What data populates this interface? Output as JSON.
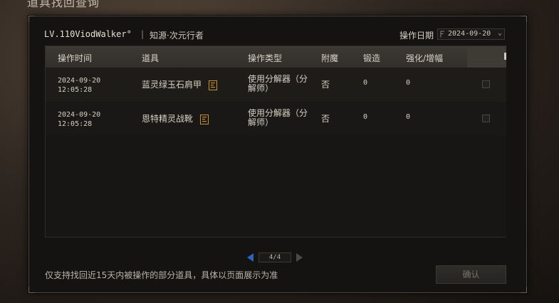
{
  "background_title": "道具找回查询",
  "header": {
    "character_name": "LV.110ViodWalker°",
    "separator": "|",
    "character_class": "知源·次元行者",
    "date_label": "操作日期",
    "date_value": "2024-09-20"
  },
  "table": {
    "columns": [
      "操作时间",
      "道具",
      "操作类型",
      "附魔",
      "锻造",
      "强化/增幅"
    ],
    "rows": [
      {
        "time_date": "2024-09-20",
        "time_clock": "12:05:28",
        "item": "蓝灵绿玉石肩甲",
        "operation": "使用分解器（分解师）",
        "enchant": "否",
        "forge": "0",
        "reinforce": "0",
        "checked": false
      },
      {
        "time_date": "2024-09-20",
        "time_clock": "12:05:28",
        "item": "恩特精灵战靴",
        "operation": "使用分解器（分解师）",
        "enchant": "否",
        "forge": "0",
        "reinforce": "0",
        "checked": false
      }
    ]
  },
  "pagination": {
    "label": "4/4"
  },
  "footer": {
    "notice": "仅支持找回近15天内被操作的部分道具，具体以页面展示为准",
    "confirm_label": "确认"
  },
  "colors": {
    "accent_arrow": "#2b63b8",
    "item_icon": "#c8902f"
  },
  "icons": {
    "date_picker": "calendar-icon",
    "dropdown": "chevron-down-icon",
    "item_detail": "item-detail-icon",
    "prev_page": "arrow-left-icon",
    "next_page": "arrow-right-icon"
  }
}
